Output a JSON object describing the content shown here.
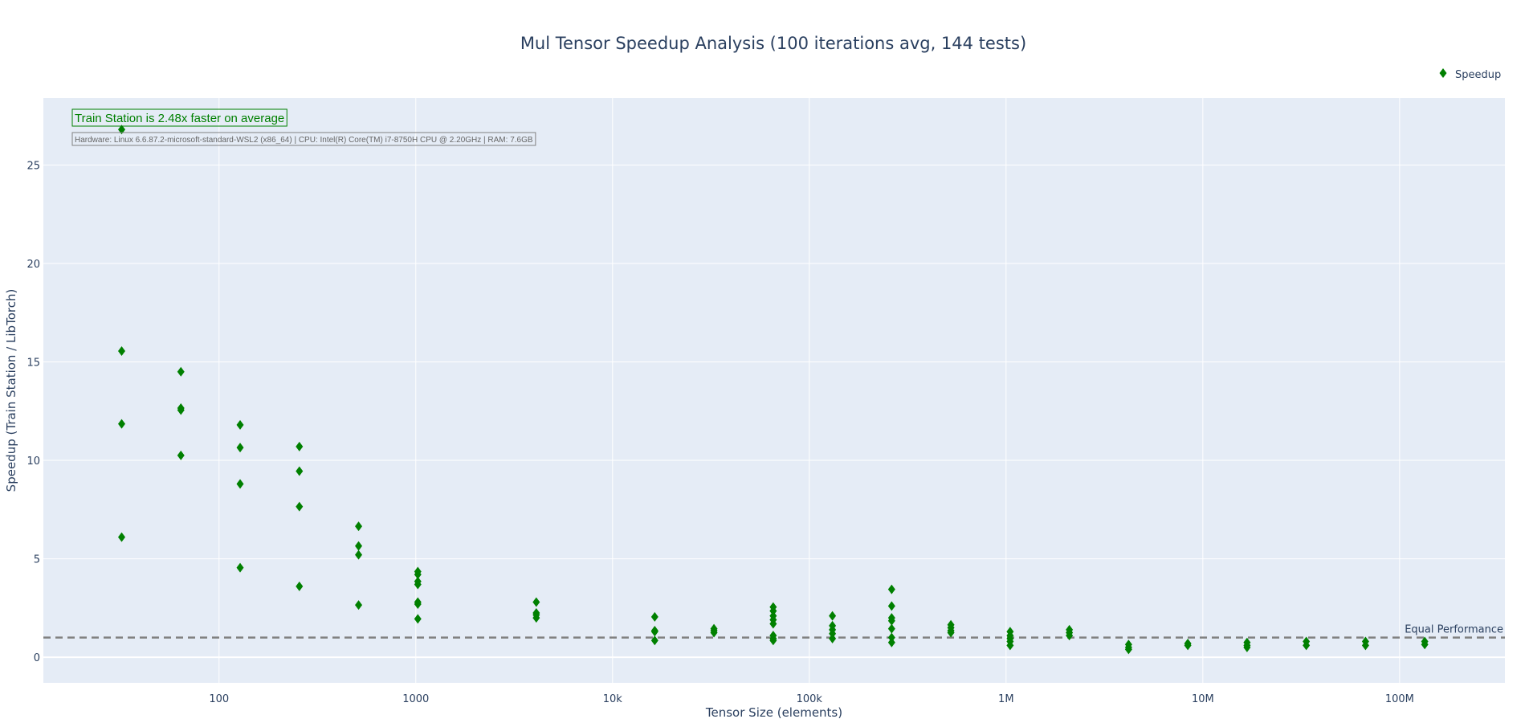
{
  "chart_data": {
    "type": "scatter",
    "title": "Mul Tensor Speedup Analysis (100 iterations avg, 144 tests)",
    "xlabel": "Tensor Size (elements)",
    "ylabel": "Speedup (Train Station / LibTorch)",
    "x_scale": "log",
    "xlim": [
      12.8,
      343000000
    ],
    "ylim": [
      -1.3,
      28.4
    ],
    "grid": true,
    "legend": {
      "placement": "top-right",
      "entries": [
        "Speedup"
      ]
    },
    "x_ticks": [
      {
        "value": 100,
        "label": "100"
      },
      {
        "value": 1000,
        "label": "1000"
      },
      {
        "value": 10000,
        "label": "10k"
      },
      {
        "value": 100000,
        "label": "100k"
      },
      {
        "value": 1000000,
        "label": "1M"
      },
      {
        "value": 10000000,
        "label": "10M"
      },
      {
        "value": 100000000,
        "label": "100M"
      }
    ],
    "y_ticks": [
      {
        "value": 0,
        "label": "0"
      },
      {
        "value": 5,
        "label": "5"
      },
      {
        "value": 10,
        "label": "10"
      },
      {
        "value": 15,
        "label": "15"
      },
      {
        "value": 20,
        "label": "20"
      },
      {
        "value": 25,
        "label": "25"
      }
    ],
    "reference_line": {
      "y": 1,
      "label": "Equal Performance",
      "color": "#808080"
    },
    "annotations": {
      "summary": "Train Station is 2.48x faster on average",
      "hardware": "Hardware: Linux 6.6.87.2-microsoft-standard-WSL2 (x86_64) | CPU: Intel(R) Core(TM) i7-8750H CPU @ 2.20GHz | RAM: 7.6GB"
    },
    "colors": {
      "marker": "#008000",
      "plot_bg": "#e5ecf6",
      "text": "#2a3f5f"
    },
    "series": [
      {
        "name": "Speedup",
        "marker": "diamond",
        "points": [
          {
            "x": 32,
            "y": [
              26.8,
              15.55,
              11.85,
              6.1
            ]
          },
          {
            "x": 64,
            "y": [
              14.5,
              12.65,
              12.55,
              10.25
            ]
          },
          {
            "x": 128,
            "y": [
              11.8,
              10.65,
              8.8,
              4.55
            ]
          },
          {
            "x": 256,
            "y": [
              10.7,
              9.45,
              7.65,
              3.6
            ]
          },
          {
            "x": 512,
            "y": [
              6.65,
              5.65,
              5.2,
              2.65
            ]
          },
          {
            "x": 1024,
            "y": [
              4.35,
              4.2,
              3.85,
              3.7,
              2.8,
              2.7,
              1.95
            ]
          },
          {
            "x": 4096,
            "y": [
              2.8,
              2.25,
              2.15,
              2.0
            ]
          },
          {
            "x": 16384,
            "y": [
              2.05,
              1.35,
              1.3,
              0.85
            ]
          },
          {
            "x": 32768,
            "y": [
              1.45,
              1.35,
              1.25
            ]
          },
          {
            "x": 65536,
            "y": [
              2.55,
              2.35,
              2.1,
              1.9,
              1.7,
              1.1,
              0.95,
              0.85
            ]
          },
          {
            "x": 131072,
            "y": [
              2.1,
              1.6,
              1.4,
              1.2,
              0.95
            ]
          },
          {
            "x": 262144,
            "y": [
              3.45,
              2.6,
              2.0,
              1.85,
              1.45,
              1.0,
              0.75
            ]
          },
          {
            "x": 524288,
            "y": [
              1.65,
              1.5,
              1.35,
              1.25
            ]
          },
          {
            "x": 1048576,
            "y": [
              1.3,
              1.1,
              0.95,
              0.8,
              0.6
            ]
          },
          {
            "x": 2097152,
            "y": [
              1.4,
              1.25,
              1.1
            ]
          },
          {
            "x": 4194304,
            "y": [
              0.65,
              0.5,
              0.4
            ]
          },
          {
            "x": 8388608,
            "y": [
              0.7,
              0.6
            ]
          },
          {
            "x": 16777216,
            "y": [
              0.75,
              0.6,
              0.5
            ]
          },
          {
            "x": 33554432,
            "y": [
              0.8,
              0.6
            ]
          },
          {
            "x": 67108864,
            "y": [
              0.8,
              0.6
            ]
          },
          {
            "x": 134217728,
            "y": [
              0.8,
              0.65
            ]
          }
        ]
      }
    ]
  }
}
